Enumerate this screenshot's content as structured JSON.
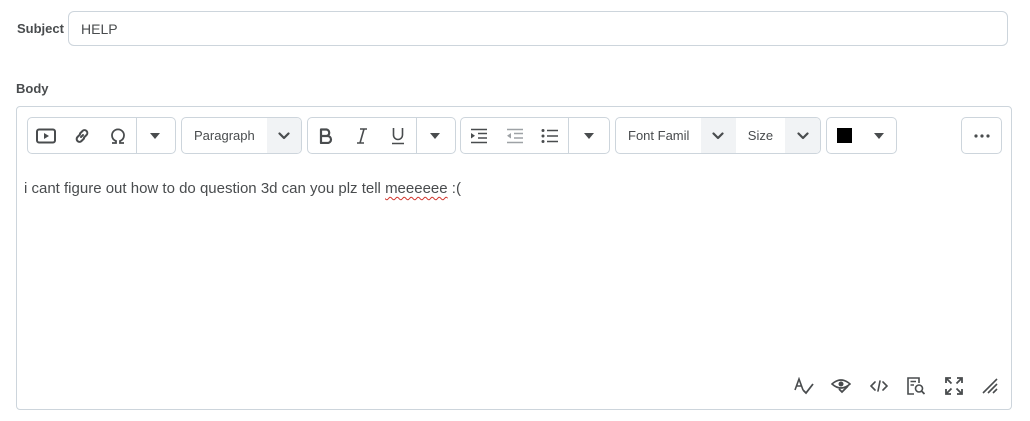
{
  "subject": {
    "label": "Subject",
    "value": "HELP"
  },
  "body": {
    "label": "Body"
  },
  "toolbar": {
    "block_format": "Paragraph",
    "font_family": "Font Famil",
    "font_size": "Size",
    "text_color": "#000000",
    "icons": [
      "insert-media-icon",
      "link-icon",
      "special-character-icon",
      "bold-icon",
      "italic-icon",
      "underline-icon",
      "indent-icon",
      "outdent-icon",
      "bullet-list-icon",
      "more-options-icon"
    ]
  },
  "editor": {
    "text_before": "i cant figure out how to do question 3d can you plz tell ",
    "misspelled_word": "meeeeee",
    "text_after": " :("
  },
  "statusbar": {
    "icons": [
      "spellcheck-icon",
      "accessibility-checker-icon",
      "source-code-icon",
      "preview-icon",
      "fullscreen-icon",
      "resize-handle-icon"
    ]
  }
}
